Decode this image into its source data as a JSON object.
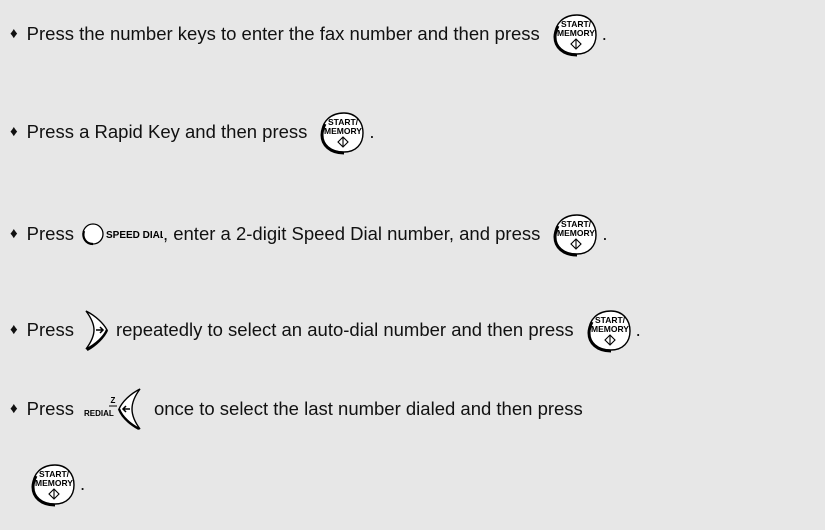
{
  "bullet": "♦",
  "start_key": {
    "line1": "START/",
    "line2": "MEMORY",
    "symbol": "◇"
  },
  "speed_dial_key": {
    "label": "SPEED DIAL"
  },
  "redial_key": {
    "top": "Z",
    "label": "REDIAL"
  },
  "period": ".",
  "instructions": [
    {
      "text_before": "Press the number keys to enter the fax number and then press"
    },
    {
      "text_before": "Press a Rapid Key and then press"
    },
    {
      "text_before": "Press",
      "text_middle": ", enter a 2-digit Speed Dial number, and press"
    },
    {
      "text_before": "Press",
      "text_middle": "repeatedly to select an auto-dial number and then press"
    },
    {
      "text_before": "Press",
      "text_middle": "once to select the last number dialed and then press"
    }
  ]
}
